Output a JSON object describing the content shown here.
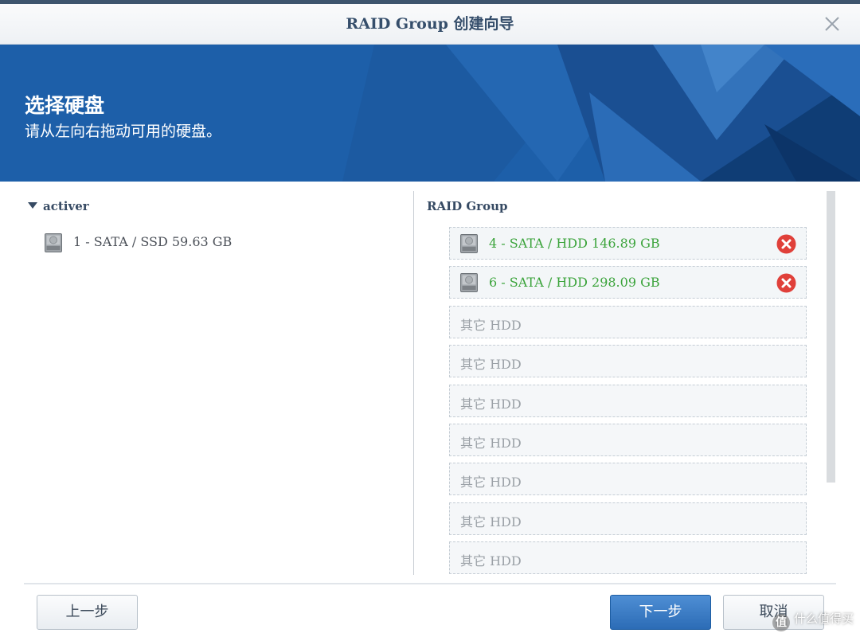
{
  "window": {
    "title": "RAID Group 创建向导"
  },
  "banner": {
    "title": "选择硬盘",
    "subtitle": "请从左向右拖动可用的硬盘。"
  },
  "left_panel": {
    "group_label": "activer",
    "disks": [
      {
        "label": "1 - SATA / SSD 59.63 GB",
        "icon": "hard-disk-icon"
      }
    ]
  },
  "right_panel": {
    "header": "RAID Group",
    "assigned_disks": [
      {
        "label": "4 - SATA / HDD 146.89 GB",
        "icon": "hard-disk-icon",
        "remove_icon": "remove-circle-icon"
      },
      {
        "label": "6 - SATA / HDD 298.09 GB",
        "icon": "hard-disk-icon",
        "remove_icon": "remove-circle-icon"
      }
    ],
    "empty_slots": [
      {
        "label": "其它 HDD"
      },
      {
        "label": "其它 HDD"
      },
      {
        "label": "其它 HDD"
      },
      {
        "label": "其它 HDD"
      },
      {
        "label": "其它 HDD"
      },
      {
        "label": "其它 HDD"
      },
      {
        "label": "其它 HDD"
      }
    ]
  },
  "footer": {
    "prev_label": "上一步",
    "next_label": "下一步",
    "cancel_label": "取消"
  },
  "watermark": {
    "badge": "值",
    "text": "什么值得买"
  },
  "colors": {
    "banner_blue": "#1d5fa9",
    "assigned_text_green": "#3aa33a",
    "remove_red": "#e0403a",
    "primary_button_blue": "#2c6cb6"
  }
}
